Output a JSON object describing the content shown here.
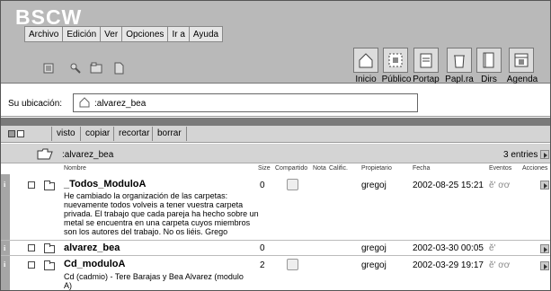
{
  "app": {
    "logo": "BSCW"
  },
  "menu": {
    "items": [
      "Archivo",
      "Edición",
      "Ver",
      "Opciones",
      "Ir a",
      "Ayuda"
    ]
  },
  "toolbar_icons": [
    "catalog-icon",
    "search-key-icon",
    "clipboard-icon",
    "document-icon"
  ],
  "nav": {
    "buttons": [
      {
        "label": "Inicio",
        "icon": "home-icon"
      },
      {
        "label": "Público",
        "icon": "public-icon"
      },
      {
        "label": "Portap",
        "icon": "clipboard-icon"
      },
      {
        "label": "Papl.ra",
        "icon": "wastebasket-icon"
      },
      {
        "label": "Dirs",
        "icon": "address-book-icon"
      },
      {
        "label": "Agenda",
        "icon": "calendar-icon"
      }
    ]
  },
  "location": {
    "label": "Su ubicación:",
    "path": ":alvarez_bea"
  },
  "actions": {
    "items": [
      "visto",
      "copiar",
      "recortar",
      "borrar"
    ]
  },
  "folder": {
    "name": ":alvarez_bea",
    "entries": "3 entries"
  },
  "columns": [
    "Nombre",
    "Size",
    "Compartido",
    "Nota",
    "Calific.",
    "Propietario",
    "Fecha",
    "Eventos",
    "Acciones"
  ],
  "rows": [
    {
      "name": "_Todos_ModuloA",
      "description": [
        "He cambiado la organización de las carpetas:",
        "nuevamente todos volveis a tener vuestra carpeta",
        "privada. El trabajo que cada pareja ha hecho sobre un",
        "metal se encuentra en una carpeta cuyos miembros",
        "son los autores del trabajo. No os liéis. Grego"
      ],
      "size": "0",
      "owner": "gregoj",
      "date": "2002-08-25 15:21",
      "events": "ĕ' ơơ"
    },
    {
      "name": "alvarez_bea",
      "description": [],
      "size": "0",
      "owner": "gregoj",
      "date": "2002-03-30 00:05",
      "events": "ĕ'"
    },
    {
      "name": "Cd_moduloA",
      "description": [
        "Cd (cadmio) - Tere Barajas y Bea Alvarez (modulo",
        "A)"
      ],
      "size": "2",
      "owner": "gregoj",
      "date": "2002-03-29 19:17",
      "events": "ĕ' ơơ"
    }
  ],
  "colors": {
    "header_bg": "#b9b9b9",
    "band": "#7a7a7a",
    "bar": "#d4d4d4"
  }
}
